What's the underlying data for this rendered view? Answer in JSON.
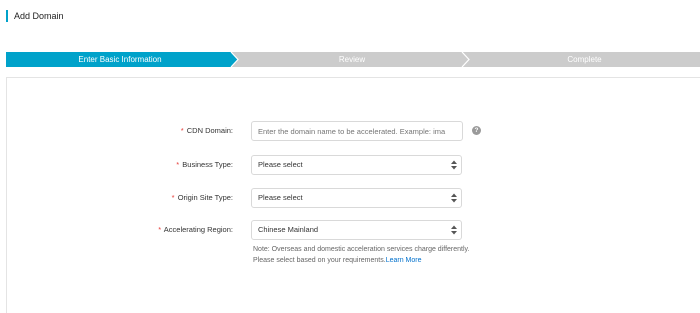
{
  "header": {
    "title": "Add Domain"
  },
  "steps": [
    {
      "label": "Enter Basic Information",
      "active": true
    },
    {
      "label": "Review",
      "active": false
    },
    {
      "label": "Complete",
      "active": false
    }
  ],
  "colors": {
    "active_step": "#00a2ca",
    "inactive_step": "#cccccc",
    "link": "#0070cc",
    "required": "#e53935"
  },
  "form": {
    "cdn_domain": {
      "label": "CDN Domain:",
      "placeholder": "Enter the domain name to be accelerated. Example: ima",
      "help_icon": "question-circle-icon"
    },
    "business_type": {
      "label": "Business Type:",
      "value": "Please select"
    },
    "origin_site_type": {
      "label": "Origin Site Type:",
      "value": "Please select"
    },
    "accelerating_region": {
      "label": "Accelerating Region:",
      "value": "Chinese Mainland"
    },
    "required_mark": "*",
    "note_line1": "Note: Overseas and domestic acceleration services charge differently.",
    "note_line2": "Please select based on your requirements.",
    "note_link": "Learn More"
  }
}
